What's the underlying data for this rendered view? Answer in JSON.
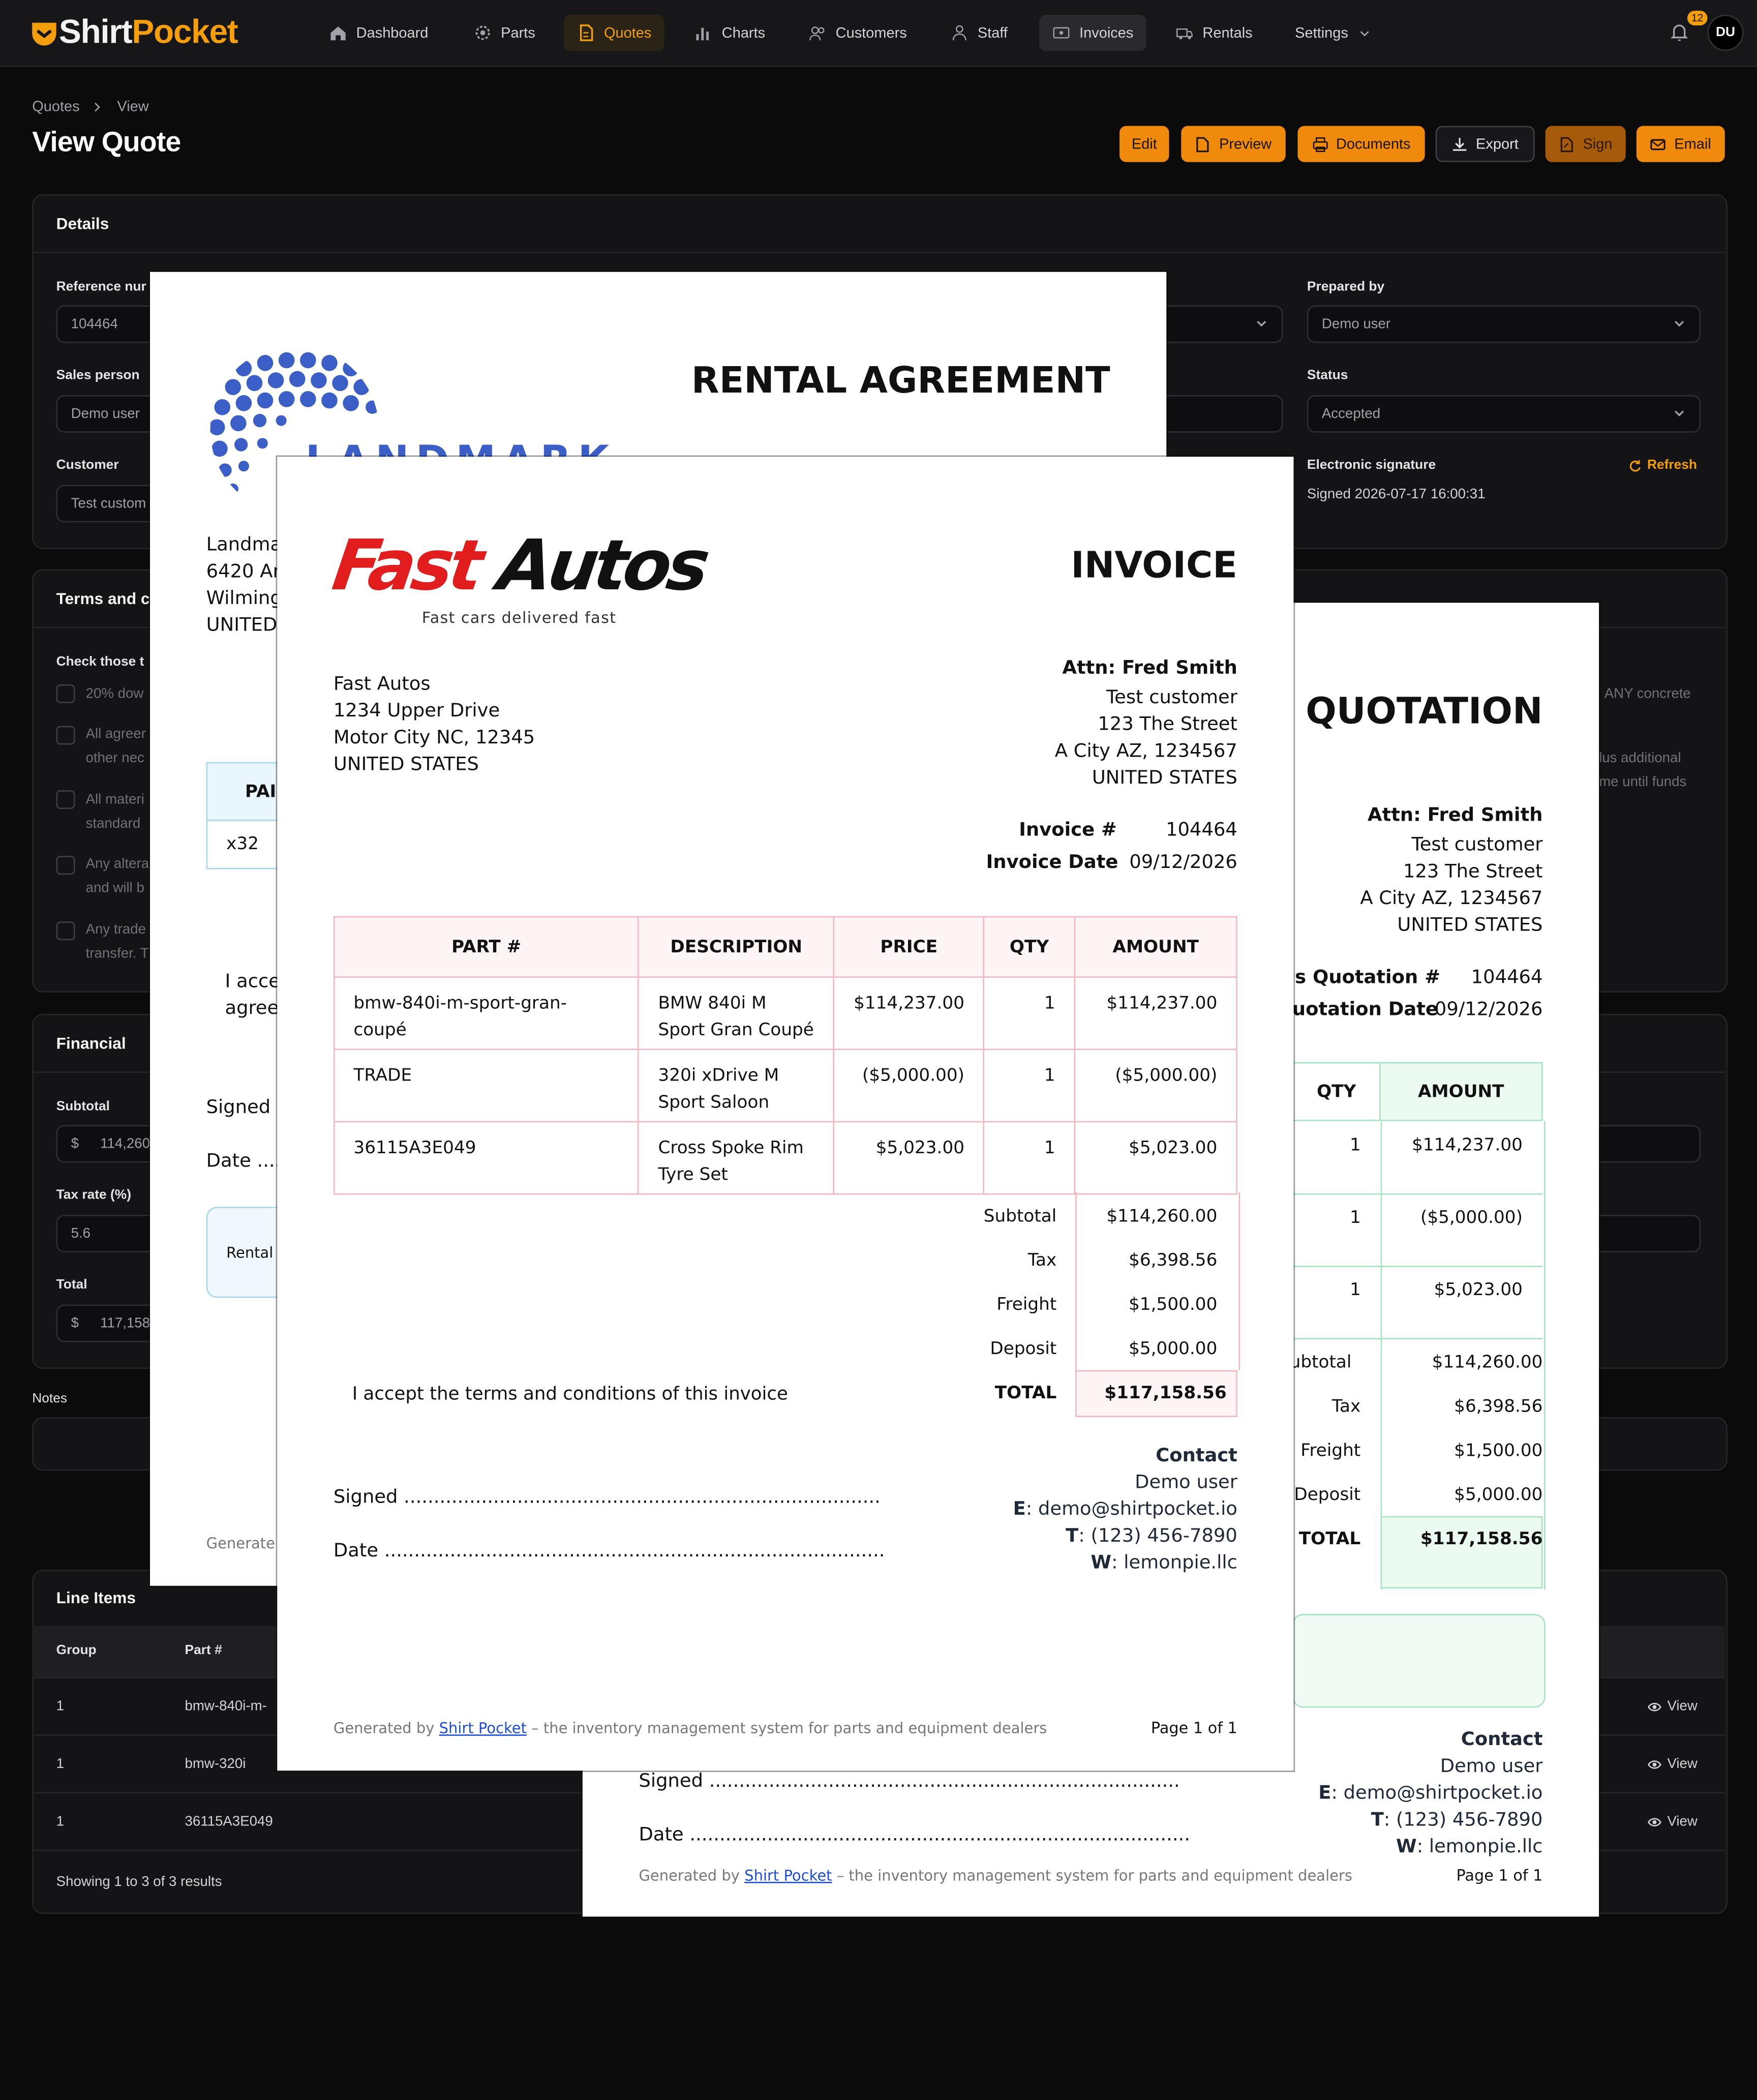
{
  "app": {
    "brand_a": "Shirt",
    "brand_b": "Pocket",
    "accent": "#f59e0b",
    "nav": [
      {
        "label": "Dashboard",
        "icon": "home-icon"
      },
      {
        "label": "Parts",
        "icon": "cog-icon"
      },
      {
        "label": "Quotes",
        "icon": "document-icon"
      },
      {
        "label": "Charts",
        "icon": "bar-chart-icon"
      },
      {
        "label": "Customers",
        "icon": "users-icon"
      },
      {
        "label": "Staff",
        "icon": "staff-icon"
      },
      {
        "label": "Invoices",
        "icon": "invoice-icon"
      },
      {
        "label": "Rentals",
        "icon": "truck-icon"
      },
      {
        "label": "Settings",
        "icon": "chevron-down-icon"
      }
    ],
    "notifications": "12",
    "avatar": "DU"
  },
  "header": {
    "breadcrumb": [
      "Quotes",
      "View"
    ],
    "title": "View Quote",
    "buttons": [
      "Edit",
      "Preview",
      "Documents",
      "Export",
      "Sign",
      "Email"
    ]
  },
  "details": {
    "title": "Details",
    "ref_label": "Reference nur",
    "ref_value": "104464",
    "sales_label": "Sales person",
    "sales_value": "Demo user",
    "customer_label": "Customer",
    "customer_value": "Test custom",
    "prepared_label": "Prepared by",
    "prepared_value": "Demo user",
    "status_label": "Status",
    "status_value": "Accepted",
    "sig_label": "Electronic signature",
    "sig_refresh": "Refresh",
    "sig_value": "Signed 2026-07-17 16:00:31"
  },
  "terms": {
    "title": "Terms and c",
    "check_label": "Check those t",
    "items": [
      "20% dow",
      "All agreer",
      "other nec",
      "All materi",
      "standard",
      "Any altera",
      "and will b",
      "Any trade",
      "transfer. T"
    ],
    "right": [
      "ANY concrete",
      "lus additional",
      "me until funds"
    ]
  },
  "financial": {
    "title": "Financial",
    "subtotal_label": "Subtotal",
    "currency": "$",
    "subtotal_value": "114,260",
    "tax_label": "Tax rate (%)",
    "tax_value": "5.6",
    "total_label": "Total",
    "total_value": "117,158"
  },
  "notes_label": "Notes",
  "line_items": {
    "title": "Line Items",
    "headers": [
      "Group",
      "Part #"
    ],
    "rows": [
      {
        "group": "1",
        "part": "bmw-840i-m-",
        "action": "View"
      },
      {
        "group": "1",
        "part": "bmw-320i",
        "action": "View"
      },
      {
        "group": "1",
        "part": "36115A3E049",
        "action": "View"
      }
    ],
    "footer": "Showing 1 to 3 of 3 results"
  },
  "rental": {
    "title": "RENTAL AGREEMENT",
    "logo_text": "LANDMARK",
    "address": [
      "Landma",
      "6420 An",
      "Wilming",
      "UNITED"
    ],
    "table_head": "PAI",
    "table_cell": "x32",
    "accept": [
      "I acce",
      "agree"
    ],
    "signed": "Signed .",
    "date": "Date ....",
    "note": "Rental",
    "footer": "Generate"
  },
  "quotation": {
    "title": "QUOTATION",
    "attn": "Attn: Fred Smith",
    "to": [
      "Test customer",
      "123 The Street",
      "A City AZ, 1234567",
      "UNITED STATES"
    ],
    "num_label": "s Quotation #",
    "num_value": "104464",
    "date_label": "uotation Date",
    "date_value": "09/12/2026",
    "col_qty": "QTY",
    "col_amount": "AMOUNT",
    "rows": [
      {
        "qty": "1",
        "amount": "$114,237.00"
      },
      {
        "qty": "1",
        "amount": "($5,000.00)"
      },
      {
        "qty": "1",
        "amount": "$5,023.00"
      }
    ],
    "totals": [
      {
        "label": "ubtotal",
        "value": "$114,260.00"
      },
      {
        "label": "Tax",
        "value": "$6,398.56"
      },
      {
        "label": "Freight",
        "value": "$1,500.00"
      },
      {
        "label": "Deposit",
        "value": "$5,000.00"
      },
      {
        "label": "TOTAL",
        "value": "$117,158.56"
      }
    ],
    "contact_title": "Contact",
    "contact_name": "Demo user",
    "email_k": "E",
    "email_v": ": demo@shirtpocket.io",
    "tel_k": "T",
    "tel_v": ": (123) 456-7890",
    "web_k": "W",
    "web_v": ": lemonpie.llc",
    "signed": "Signed ...............................................................................",
    "date": "Date ....................................................................................",
    "gen_a": "Generated by",
    "gen_link": "Shirt Pocket",
    "gen_b": "– the inventory management system for parts and equipment dealers",
    "page": "Page 1 of 1"
  },
  "invoice": {
    "brand_a": "Fast",
    "brand_b": "Autos",
    "tagline": "Fast cars delivered fast",
    "title": "INVOICE",
    "from": [
      "Fast Autos",
      "1234 Upper Drive",
      "Motor City NC, 12345",
      "UNITED STATES"
    ],
    "attn": "Attn: Fred Smith",
    "to": [
      "Test customer",
      "123 The Street",
      "A City AZ, 1234567",
      "UNITED STATES"
    ],
    "num_label": "Invoice #",
    "num_value": "104464",
    "date_label": "Invoice Date",
    "date_value": "09/12/2026",
    "headers": [
      "PART #",
      "DESCRIPTION",
      "PRICE",
      "QTY",
      "AMOUNT"
    ],
    "rows": [
      {
        "part": "bmw-840i-m-sport-gran-coupé",
        "desc1": "BMW 840i M",
        "desc2": "Sport Gran Coupé",
        "price": "$114,237.00",
        "qty": "1",
        "amount": "$114,237.00"
      },
      {
        "part": "TRADE",
        "desc1": "320i xDrive M",
        "desc2": "Sport Saloon",
        "price": "($5,000.00)",
        "qty": "1",
        "amount": "($5,000.00)"
      },
      {
        "part": "36115A3E049",
        "desc1": "Cross Spoke Rim",
        "desc2": "Tyre Set",
        "price": "$5,023.00",
        "qty": "1",
        "amount": "$5,023.00"
      }
    ],
    "totals": [
      {
        "label": "Subtotal",
        "value": "$114,260.00"
      },
      {
        "label": "Tax",
        "value": "$6,398.56"
      },
      {
        "label": "Freight",
        "value": "$1,500.00"
      },
      {
        "label": "Deposit",
        "value": "$5,000.00"
      }
    ],
    "total_label": "TOTAL",
    "total_value": "$117,158.56",
    "accept": "I accept the terms and conditions of this invoice",
    "contact_title": "Contact",
    "contact_name": "Demo user",
    "email_k": "E",
    "email_v": ": demo@shirtpocket.io",
    "tel_k": "T",
    "tel_v": ": (123) 456-7890",
    "web_k": "W",
    "web_v": ": lemonpie.llc",
    "signed": "Signed ................................................................................",
    "date": "Date ....................................................................................",
    "gen_a": "Generated by",
    "gen_link": "Shirt Pocket",
    "gen_b": "– the inventory management system for parts and equipment dealers",
    "page": "Page 1 of 1"
  }
}
